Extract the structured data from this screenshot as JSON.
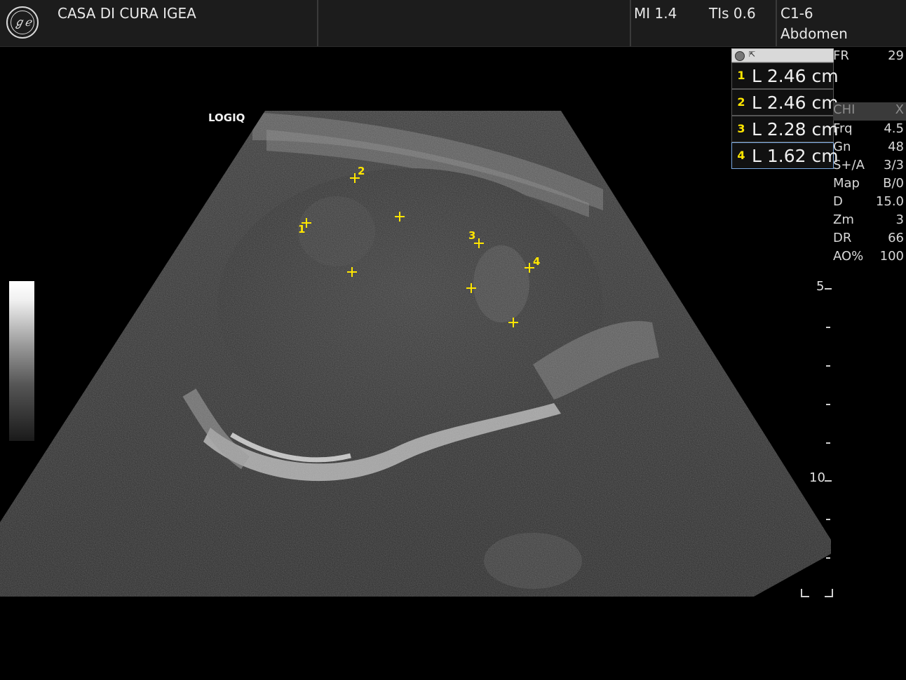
{
  "header": {
    "facility": "CASA DI CURA IGEA",
    "mi": "MI 1.4",
    "tis": "TIs 0.6",
    "probe": "C1-6",
    "preset": "Abdomen"
  },
  "image": {
    "brand_label": "LOGIQ"
  },
  "measurements": [
    {
      "num": "1",
      "value": "L  2.46 cm"
    },
    {
      "num": "2",
      "value": "L  2.46 cm"
    },
    {
      "num": "3",
      "value": "L  2.28 cm"
    },
    {
      "num": "4",
      "value": "L  1.62 cm"
    }
  ],
  "caliper_labels": [
    "1",
    "2",
    "3",
    "4"
  ],
  "params": [
    {
      "k": "FR",
      "v": "29"
    },
    {
      "k": "CHI",
      "v": "X"
    },
    {
      "k": "Frq",
      "v": "4.5"
    },
    {
      "k": "Gn",
      "v": "48"
    },
    {
      "k": "S+/A",
      "v": "3/3"
    },
    {
      "k": "Map",
      "v": "B/0"
    },
    {
      "k": "D",
      "v": "15.0"
    },
    {
      "k": "Zm",
      "v": "3"
    },
    {
      "k": "DR",
      "v": "66"
    },
    {
      "k": "AO%",
      "v": "100"
    }
  ],
  "depth_scale": {
    "label_5": "5",
    "label_10": "10"
  },
  "colors": {
    "caliper": "#ffe600",
    "active_border": "#7aa8e0"
  }
}
